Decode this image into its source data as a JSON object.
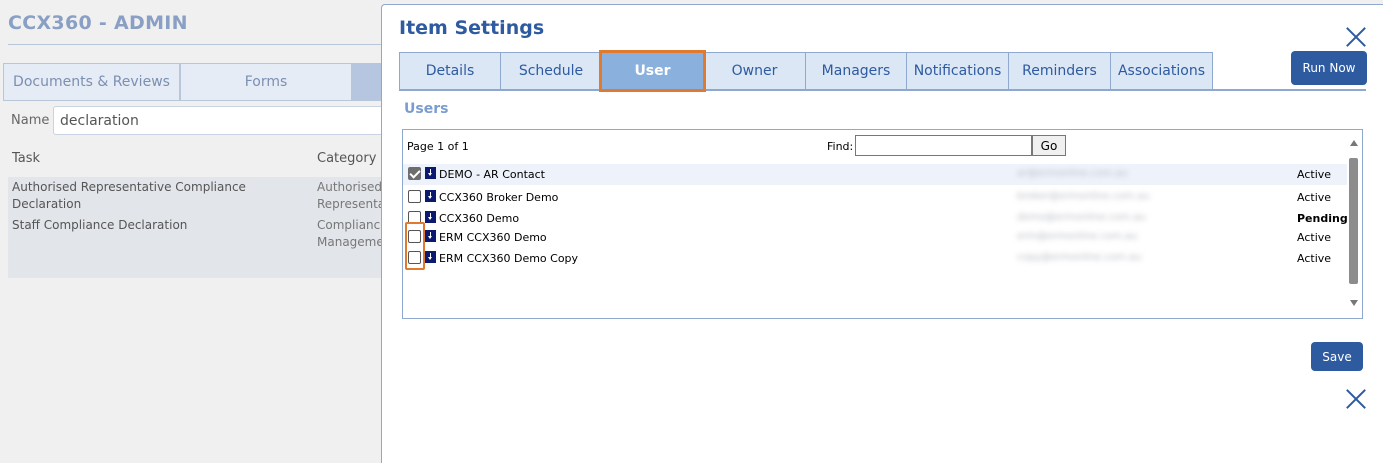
{
  "background": {
    "title": "CCX360 - ADMIN",
    "tabs": [
      {
        "label": "Documents & Reviews"
      },
      {
        "label": "Forms"
      },
      {
        "label": ""
      }
    ],
    "name_label": "Name",
    "name_value": "declaration",
    "columns": {
      "task": "Task",
      "category": "Category"
    },
    "rows": [
      {
        "task": "Authorised Representative Compliance Declaration",
        "category": "Authorised Representative"
      },
      {
        "task": "Staff Compliance Declaration",
        "category": "Compliance Management"
      }
    ]
  },
  "modal": {
    "title": "Item Settings",
    "tabs": [
      {
        "label": "Details"
      },
      {
        "label": "Schedule"
      },
      {
        "label": "User",
        "active": true
      },
      {
        "label": "Owner"
      },
      {
        "label": "Managers"
      },
      {
        "label": "Notifications"
      },
      {
        "label": "Reminders"
      },
      {
        "label": "Associations"
      }
    ],
    "run_now_label": "Run Now",
    "section_label": "Users",
    "pager": "Page 1 of 1",
    "find_label": "Find:",
    "find_value": "",
    "go_label": "Go",
    "users": [
      {
        "name": "DEMO - AR Contact",
        "email": "ar@ermonline.com.au",
        "status": "Active",
        "checked": true,
        "status_bold": false
      },
      {
        "name": "CCX360 Broker Demo",
        "email": "broker@ermonline.com.au",
        "status": "Active",
        "checked": false,
        "status_bold": false
      },
      {
        "name": "CCX360 Demo",
        "email": "demo@ermonline.com.au",
        "status": "Pending",
        "checked": false,
        "status_bold": true
      },
      {
        "name": "ERM CCX360 Demo",
        "email": "erm@ermonline.com.au",
        "status": "Active",
        "checked": false,
        "status_bold": false
      },
      {
        "name": "ERM CCX360 Demo Copy",
        "email": "copy@ermonline.com.au",
        "status": "Active",
        "checked": false,
        "status_bold": false
      }
    ],
    "save_label": "Save"
  },
  "colors": {
    "primary": "#2e5aa0",
    "highlight": "#e07a2e",
    "tab_bg": "#dce7f5",
    "active_tab_bg": "#8ab0de"
  },
  "icons": {
    "close": "close-icon",
    "download": "download-arrow-icon",
    "checkbox": "checkbox-icon"
  }
}
